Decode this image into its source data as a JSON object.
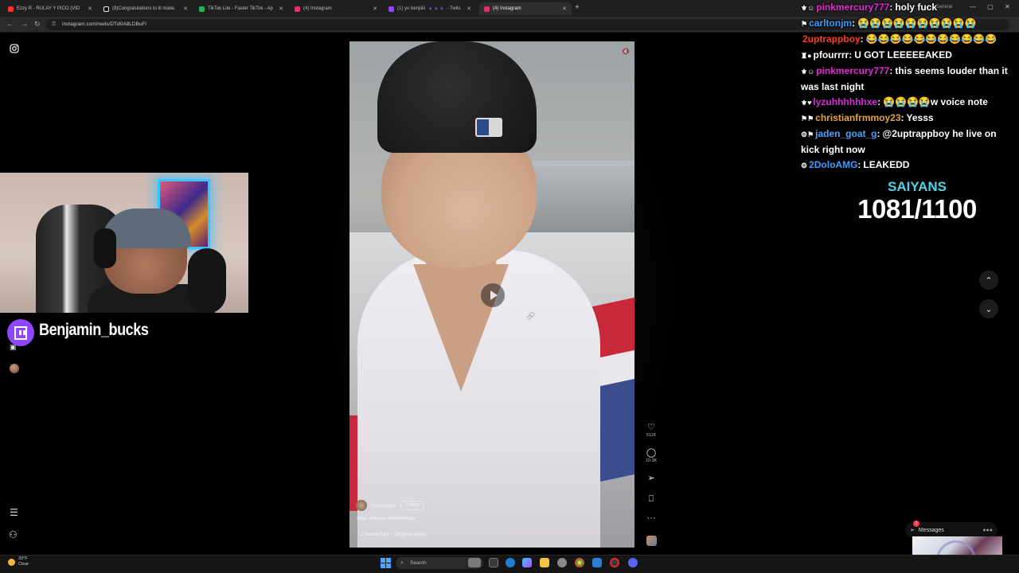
{
  "browser": {
    "tabs": [
      {
        "label": "Ezzy R - RULAY Y PICO (VID",
        "color": "#ff2f2f"
      },
      {
        "label": "(8)Congratulations to lil mabu",
        "color": "#111111"
      },
      {
        "label": "TikTok Lite - Faster TikTok - Ap",
        "color": "#1fb35a"
      },
      {
        "label": "(4) Instagram",
        "color": "#e1306c"
      },
      {
        "label": "(1) yo benjiiiii",
        "color": "#9146ff"
      },
      {
        "label": "(4) Instagram",
        "color": "#e1306c"
      }
    ],
    "tab_suffix_twitch": "- Twitc",
    "new_tab": "+",
    "url": "instagram.com/reels/DTd0A8LDBuF/",
    "profile_label": "General"
  },
  "webcam": {
    "streamer_name": "Benjamin_bucks",
    "platform_icon": "twitch-icon"
  },
  "reel": {
    "author": "bonnedgio",
    "follow_label": "Follow",
    "hashtags": "#nyc #nissan #dominican",
    "audio": "bonnedgio · Original audio",
    "actions": {
      "likes": "911K",
      "comments": "10.3K",
      "more": "···"
    }
  },
  "chat": {
    "messages": [
      {
        "badges": "⚜☺",
        "user": "pinkmercury777",
        "color": "#e62bd6",
        "text": "holy fuck"
      },
      {
        "badges": "⚑",
        "user": "carltonjm",
        "color": "#3f9cff",
        "text": "😭😭😭😭😭😭😭😭😭😭"
      },
      {
        "badges": "",
        "user": "2uptrappboy",
        "color": "#ff3b1f",
        "text": "😂😂😂😂😂😂😂😂😂😂😂"
      },
      {
        "badges": "♜●",
        "user": "pfourrrr",
        "color": "#ffffff",
        "text": "U GOT LEEEEEAKED"
      },
      {
        "badges": "⚜☺",
        "user": "pinkmercury777",
        "color": "#e62bd6",
        "text": "this seems louder than it was last night"
      },
      {
        "badges": "⚜♥",
        "user": "lyzuhhhhhhxe",
        "color": "#d92bd6",
        "text": "😭😭😭😭w voice note"
      },
      {
        "badges": "⚑⚑",
        "user": "christianfrmmoy23",
        "color": "#e3a43a",
        "text": "Yesss"
      },
      {
        "badges": "⚙⚑",
        "user": "jaden_goat_g",
        "color": "#4aa4ff",
        "text": "@2uptrappboy he live on kick right now"
      },
      {
        "badges": "⚙",
        "user": "2DoloAMG",
        "color": "#3f9cff",
        "text": "LEAKEDD"
      }
    ],
    "goal_label": "SAIYANS",
    "goal_count": "1081/1100"
  },
  "instagram": {
    "messages_label": "Messages",
    "messages_count": "1"
  },
  "taskbar": {
    "weather_temp": "33°F",
    "weather_desc": "Clear",
    "search_placeholder": "Search"
  }
}
